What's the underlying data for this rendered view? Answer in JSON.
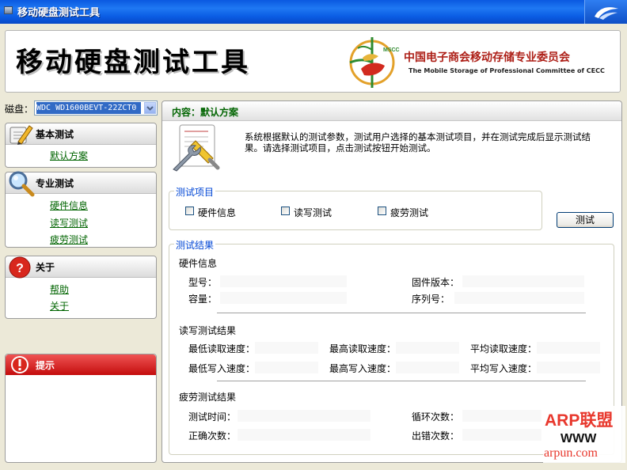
{
  "window": {
    "title": "移动硬盘测试工具"
  },
  "banner": {
    "title": "移动硬盘测试工具",
    "logo_text": "MSCC",
    "org_cn": "中国电子商会移动存储专业委员会",
    "org_en": "The Mobile Storage of Professional Committee of CECC"
  },
  "disk": {
    "label": "磁盘：",
    "selected": "WDC WD1600BEVT-22ZCT0"
  },
  "sidebar": {
    "basic": {
      "title": "基本测试",
      "items": [
        "默认方案"
      ]
    },
    "pro": {
      "title": "专业测试",
      "items": [
        "硬件信息",
        "读写测试",
        "疲劳测试"
      ]
    },
    "about": {
      "title": "关于",
      "items": [
        "帮助",
        "关于"
      ]
    },
    "tip": {
      "title": "提示"
    }
  },
  "content": {
    "header": "内容：默认方案",
    "description": "系统根据默认的测试参数，测试用户选择的基本测试项目，并在测试完成后显示测试结果。请选择测试项目，点击测试按钮开始测试。",
    "test_items": {
      "legend": "测试项目",
      "options": [
        {
          "label": "硬件信息",
          "checked": false
        },
        {
          "label": "读写测试",
          "checked": false
        },
        {
          "label": "疲劳测试",
          "checked": false
        }
      ]
    },
    "test_button": "测试",
    "results": {
      "legend": "测试结果",
      "hardware": {
        "title": "硬件信息",
        "model_label": "型号：",
        "firmware_label": "固件版本：",
        "capacity_label": "容量：",
        "serial_label": "序列号：",
        "model": "",
        "firmware": "",
        "capacity": "",
        "serial": ""
      },
      "rw": {
        "title": "读写测试结果",
        "min_read": "最低读取速度：",
        "max_read": "最高读取速度：",
        "avg_read": "平均读取速度：",
        "min_write": "最低写入速度：",
        "max_write": "最高写入速度：",
        "avg_write": "平均写入速度："
      },
      "fatigue": {
        "title": "疲劳测试结果",
        "time": "测试时间：",
        "loops": "循环次数：",
        "correct": "正确次数：",
        "errors": "出错次数："
      }
    }
  },
  "watermark": {
    "line1": "ARP联盟",
    "line2": "WWW",
    "line3": "arpun.com"
  },
  "colors": {
    "titlebar": "#0a59e0",
    "link_green": "#006400",
    "legend_blue": "#0046d5",
    "banner_red": "#ad1f17",
    "tip_red": "#c40d0d"
  }
}
